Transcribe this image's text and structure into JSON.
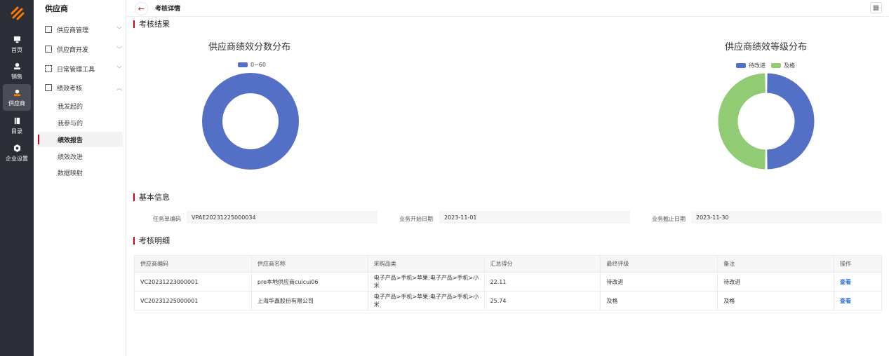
{
  "rail": {
    "items": [
      {
        "label": "首页",
        "icon": "monitor-icon"
      },
      {
        "label": "销售",
        "icon": "user-icon"
      },
      {
        "label": "供应商",
        "icon": "supplier-icon"
      },
      {
        "label": "目录",
        "icon": "catalog-icon"
      },
      {
        "label": "企业设置",
        "icon": "settings-icon"
      }
    ],
    "active_index": 2
  },
  "sidebar": {
    "title": "供应商",
    "menus": [
      {
        "label": "供应商管理",
        "icon": "list-icon"
      },
      {
        "label": "供应商开发",
        "icon": "develop-icon"
      },
      {
        "label": "日常管理工具",
        "icon": "grid-icon"
      },
      {
        "label": "绩效考核",
        "icon": "chart-icon"
      }
    ],
    "subs": [
      {
        "label": "我发起的"
      },
      {
        "label": "我参与的"
      },
      {
        "label": "绩效报告"
      },
      {
        "label": "绩效改进"
      },
      {
        "label": "数据映射"
      }
    ],
    "active_sub": 2
  },
  "topbar": {
    "title": "考核详情",
    "back_icon": "arrow-left-icon",
    "layout_icon": "layout-icon"
  },
  "sections": {
    "result": "考核结果",
    "basic": "基本信息",
    "detail": "考核明细"
  },
  "colors": {
    "accent": "#d0021b",
    "blue": "#5470c6",
    "green": "#91cc75",
    "link": "#2f6fdc"
  },
  "charts": {
    "score": {
      "title": "供应商绩效分数分布",
      "legend": [
        "0~60"
      ]
    },
    "grade": {
      "title": "供应商绩效等级分布",
      "legend": [
        "待改进",
        "及格"
      ]
    }
  },
  "chart_data": [
    {
      "type": "pie",
      "title": "供应商绩效分数分布",
      "categories": [
        "0~60"
      ],
      "values": [
        2
      ],
      "colors": [
        "#5470c6"
      ],
      "legend": "top"
    },
    {
      "type": "pie",
      "title": "供应商绩效等级分布",
      "categories": [
        "待改进",
        "及格"
      ],
      "values": [
        1,
        1
      ],
      "colors": [
        "#5470c6",
        "#91cc75"
      ],
      "legend": "top"
    }
  ],
  "basic_info": {
    "task_no_label": "任务单编码",
    "task_no": "VPAE20231225000034",
    "start_label": "业务开始日期",
    "start": "2023-11-01",
    "end_label": "业务截止日期",
    "end": "2023-11-30"
  },
  "table": {
    "headers": [
      "供应商编码",
      "供应商名称",
      "采购品类",
      "汇总得分",
      "最终评级",
      "备注",
      "操作"
    ],
    "rows": [
      [
        "VC20231223000001",
        "pre本地供应商cuicui06",
        "电子产品>手机>苹果;电子产品>手机>小米",
        "22.11",
        "待改进",
        "待改进",
        "查看"
      ],
      [
        "VC20231225000001",
        "上海华鑫股份有限公司",
        "电子产品>手机>苹果;电子产品>手机>小米",
        "25.74",
        "及格",
        "及格",
        "查看"
      ]
    ]
  }
}
